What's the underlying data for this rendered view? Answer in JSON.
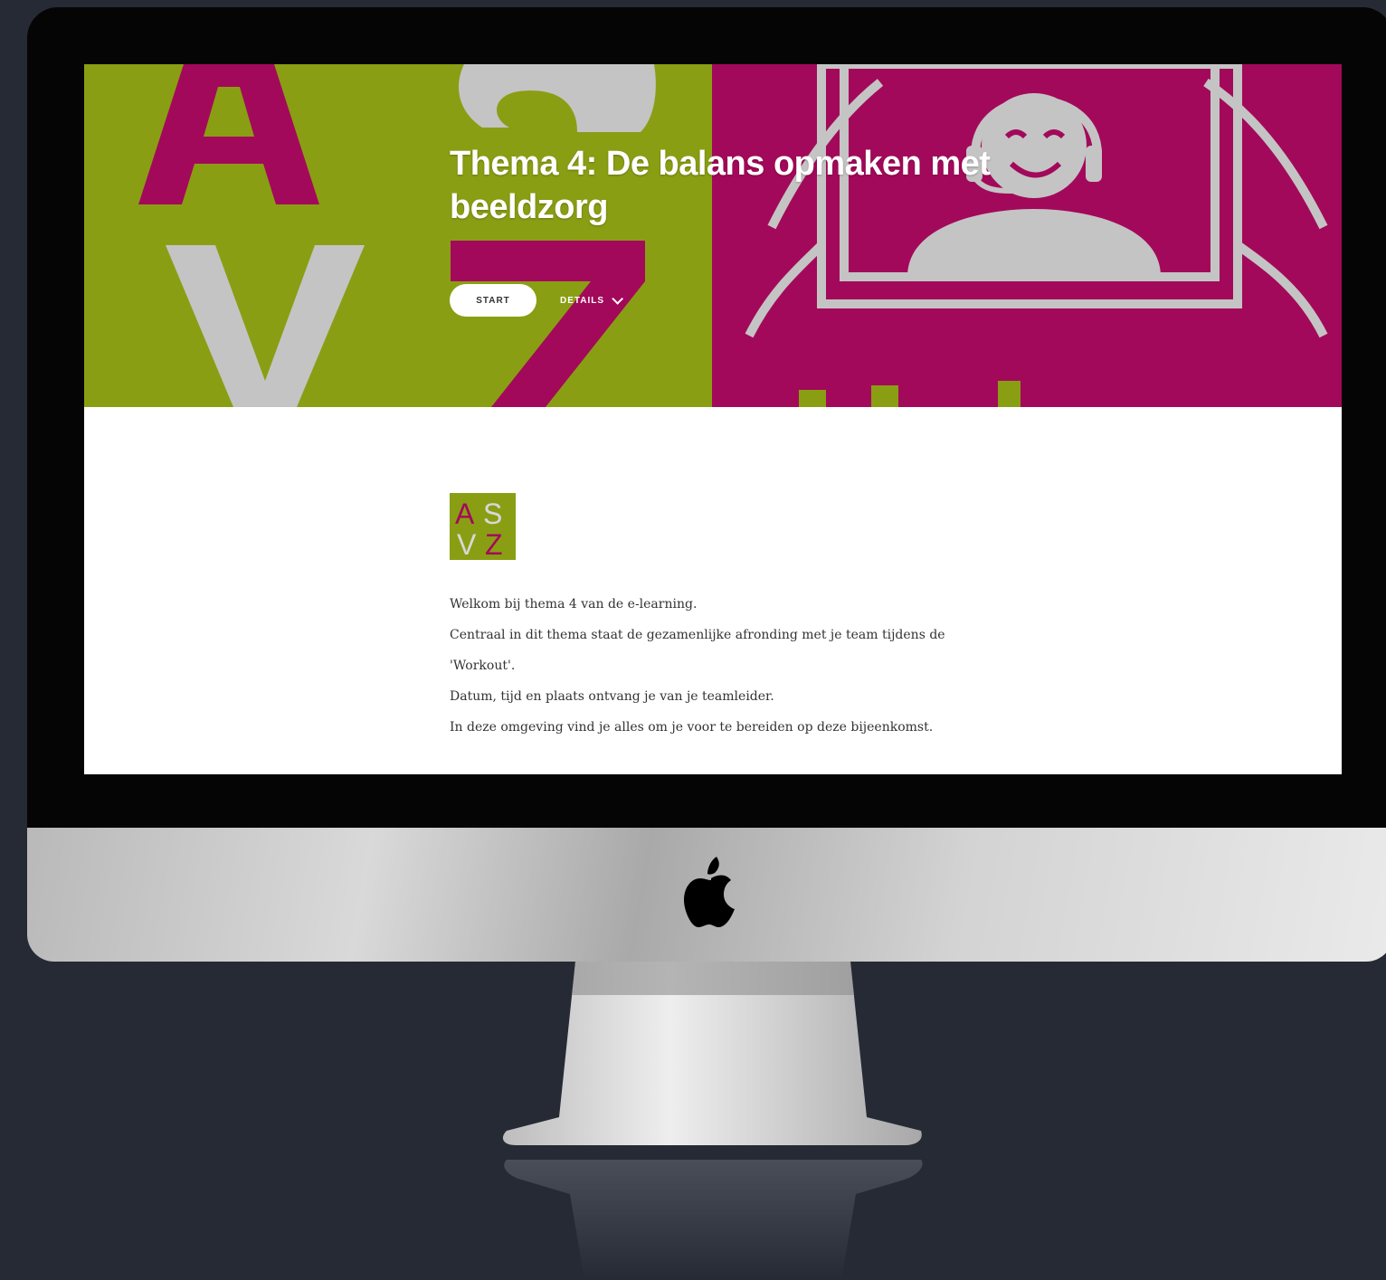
{
  "hero": {
    "title": "Thema 4: De balans opmaken met beeldzorg",
    "start_label": "START",
    "details_label": "DETAILS"
  },
  "logo": {
    "letters": [
      "A",
      "S",
      "V",
      "Z"
    ]
  },
  "intro": {
    "lines": [
      "Welkom bij thema 4 van de e-learning.",
      "Centraal in dit thema staat de gezamenlijke afronding met je team tijdens de 'Workout'.",
      "Datum, tijd en plaats ontvang je van je teamleider.",
      "In deze omgeving vind je alles om je voor te bereiden op deze bijeenkomst."
    ]
  },
  "colors": {
    "brand_green": "#8a9e14",
    "brand_magenta": "#a3095a",
    "letter_gray": "#c4c4c4",
    "backdrop": "#262a35"
  },
  "icons": [
    "apple-logo-icon",
    "chevron-down-icon",
    "headset-person-icon"
  ]
}
